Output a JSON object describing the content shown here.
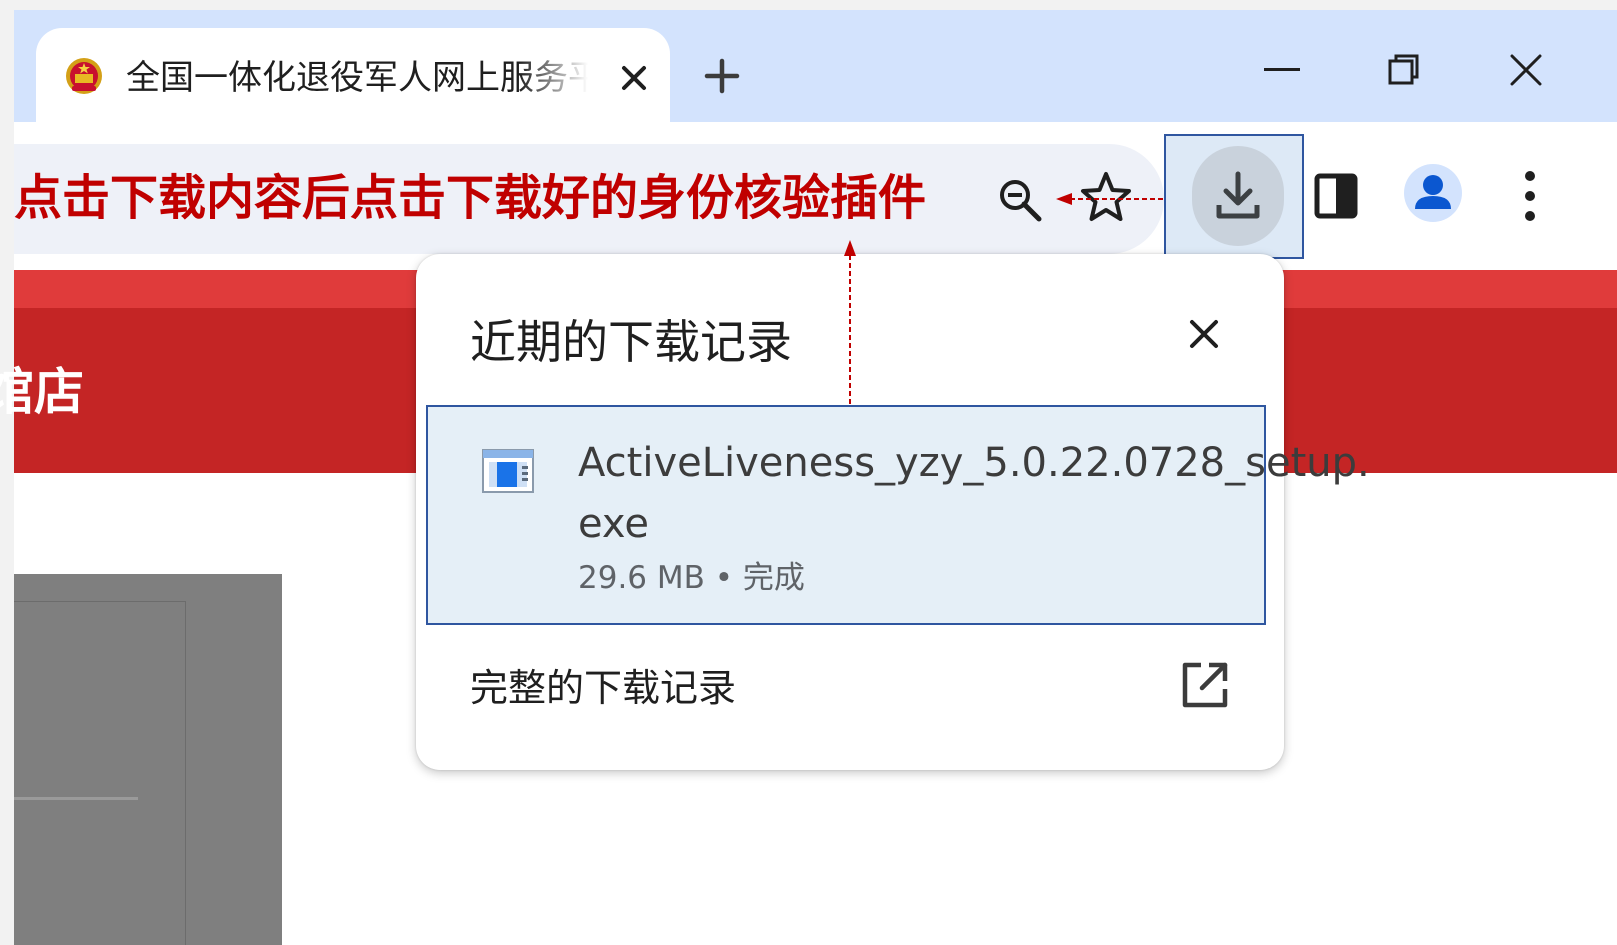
{
  "browser": {
    "tab": {
      "title": "全国一体化退役军人网上服务平",
      "favicon": "national-emblem-icon"
    },
    "new_tab_label": "+",
    "window_controls": [
      "minimize-icon",
      "maximize-icon",
      "close-icon"
    ],
    "toolbar": {
      "icons": [
        "zoom-icon",
        "bookmark-star-icon",
        "download-icon",
        "side-panel-icon",
        "profile-icon",
        "more-menu-icon"
      ]
    }
  },
  "annotation": {
    "text": "点击下载内容后点击下载好的身份核验插件",
    "color": "#c00000"
  },
  "page": {
    "header_partial_text": "馆店",
    "header_color": "#c42525"
  },
  "downloads_bubble": {
    "title": "近期的下载记录",
    "item": {
      "file_name_line1": "ActiveLiveness_yzy_5.0.22.0728_setup.",
      "file_name_line2": "exe",
      "meta": "29.6 MB • 完成"
    },
    "full_history_label": "完整的下载记录"
  },
  "colors": {
    "tabbar": "#d3e3fd",
    "omnibox": "#eef1f8",
    "highlight_border": "#2f56a0",
    "highlight_fill": "#e5eff7"
  }
}
